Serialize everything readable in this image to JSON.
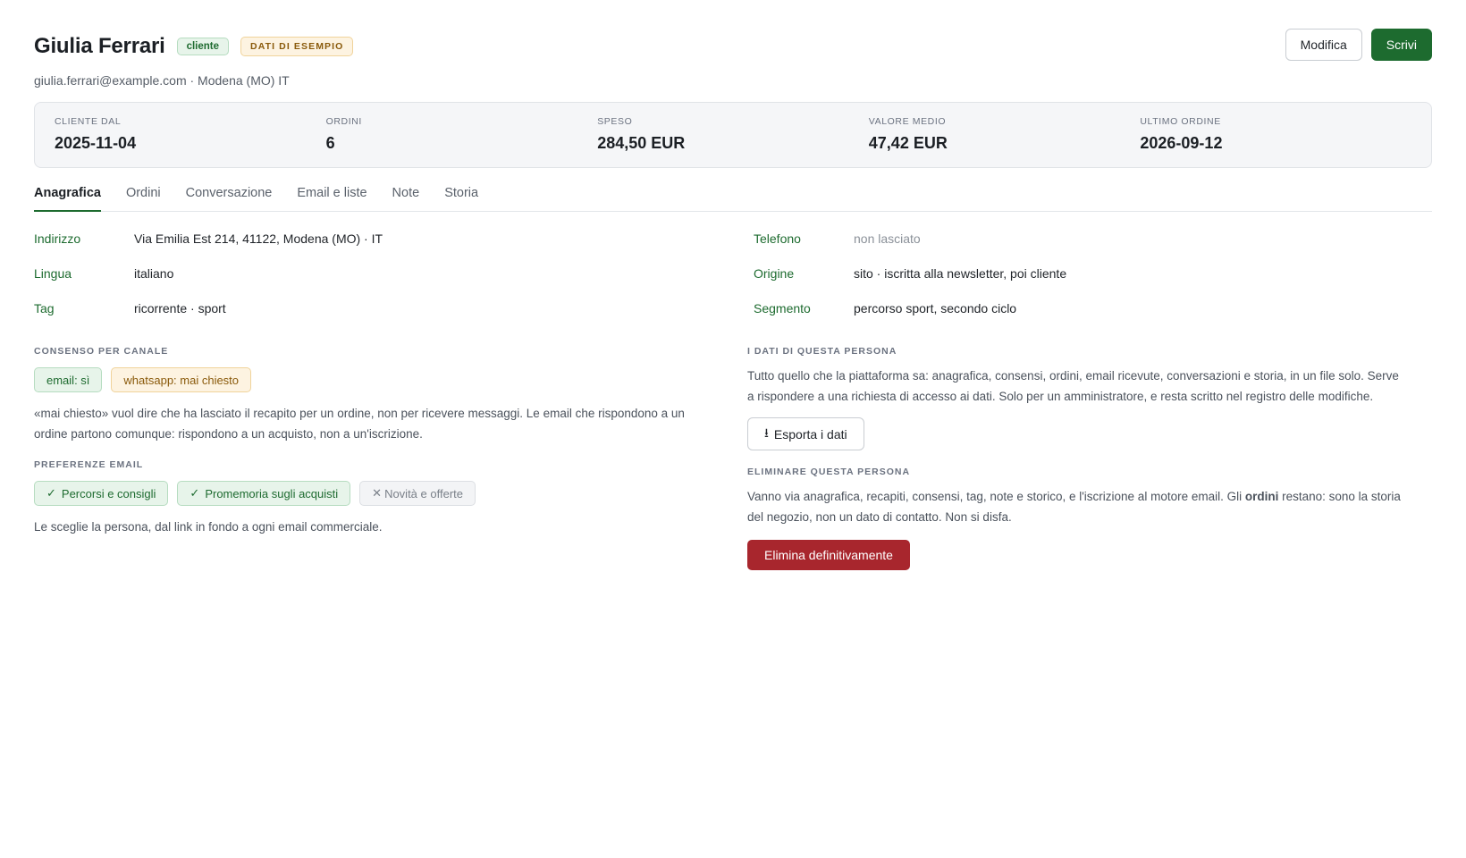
{
  "customer": {
    "name": "Giulia Ferrari",
    "badge": "cliente",
    "demo_badge": "DATI DI ESEMPIO",
    "subtitle": "giulia.ferrari@example.com · Modena (MO) IT"
  },
  "actions": {
    "edit": "Modifica",
    "write": "Scrivi"
  },
  "stats": [
    {
      "label": "CLIENTE DAL",
      "value": "2025-11-04"
    },
    {
      "label": "ORDINI",
      "value": "6"
    },
    {
      "label": "SPESO",
      "value": "284,50 EUR"
    },
    {
      "label": "VALORE MEDIO",
      "value": "47,42 EUR"
    },
    {
      "label": "ULTIMO ORDINE",
      "value": "2026-09-12"
    }
  ],
  "tabs": [
    "Anagrafica",
    "Ordini",
    "Conversazione",
    "Email e liste",
    "Note",
    "Storia"
  ],
  "fields_left": [
    {
      "label": "Indirizzo",
      "value": "Via Emilia Est 214, 41122, Modena (MO) · IT"
    },
    {
      "label": "Lingua",
      "value": "italiano"
    },
    {
      "label": "Tag",
      "value": "ricorrente · sport"
    }
  ],
  "fields_right": [
    {
      "label": "Telefono",
      "value": "non lasciato"
    },
    {
      "label": "Origine",
      "value": "sito · iscritta alla newsletter, poi cliente"
    },
    {
      "label": "Segmento",
      "value": "percorso sport, secondo ciclo"
    }
  ],
  "consent": {
    "title": "CONSENSO PER CANALE",
    "chips": [
      "email: sì",
      "whatsapp: mai chiesto"
    ],
    "note": "«mai chiesto» vuol dire che ha lasciato il recapito per un ordine, non per ricevere messaggi. Le email che rispondono a un ordine partono comunque: rispondono a un acquisto, non a un'iscrizione."
  },
  "email_prefs": {
    "title": "PREFERENZE EMAIL",
    "chips": [
      {
        "mark": "✓",
        "label": "Percorsi e consigli"
      },
      {
        "mark": "✓",
        "label": "Promemoria sugli acquisti"
      },
      {
        "mark": "✕",
        "label": "Novità e offerte"
      }
    ],
    "note": "Le sceglie la persona, dal link in fondo a ogni email commerciale."
  },
  "data_export": {
    "title": "I DATI DI QUESTA PERSONA",
    "text": "Tutto quello che la piattaforma sa: anagrafica, consensi, ordini, email ricevute, conversazioni e storia, in un file solo. Serve a rispondere a una richiesta di accesso ai dati. Solo per un amministratore, e resta scritto nel registro delle modifiche.",
    "button_icon": "⭳",
    "button": "Esporta i dati"
  },
  "delete": {
    "title": "ELIMINARE QUESTA PERSONA",
    "text_before": "Vanno via anagrafica, recapiti, consensi, tag, note e storico, e l'iscrizione al motore email. Gli ",
    "text_bold": "ordini",
    "text_after": " restano: sono la storia del negozio, non un dato di contatto. Non si disfa.",
    "button": "Elimina definitivamente"
  },
  "icons": {
    "download": "download-icon",
    "check": "check-icon",
    "cross": "cross-icon"
  },
  "colors": {
    "accent": "#1d6b2f",
    "danger": "#a8262d",
    "warning": "#8a5a0b"
  }
}
